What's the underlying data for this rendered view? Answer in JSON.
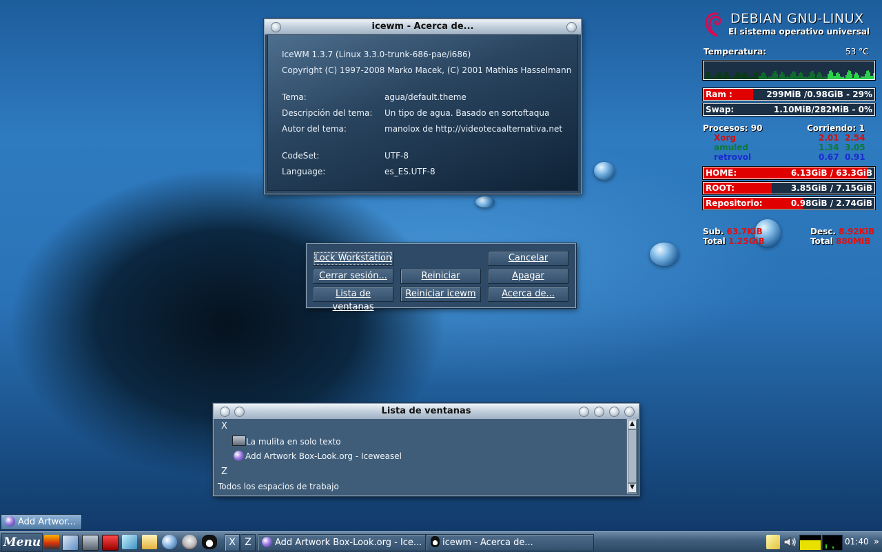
{
  "about": {
    "title": "icewm - Acerca de...",
    "version": "IceWM 1.3.7 (Linux 3.3.0-trunk-686-pae/i686)",
    "copyright": "Copyright (C) 1997-2008 Marko Macek, (C) 2001 Mathias Hasselmann",
    "theme_key": "Tema:",
    "theme_val": "agua/default.theme",
    "desc_key": "Descripción del tema:",
    "desc_val": "Un tipo de agua. Basado en sortoftaqua",
    "author_key": "Autor del tema:",
    "author_val": "manolox de http://videotecaalternativa.net",
    "codeset_key": "CodeSet:",
    "codeset_val": "UTF-8",
    "lang_key": "Language:",
    "lang_val": "es_ES.UTF-8"
  },
  "logout": {
    "lock": "Lock Workstation",
    "cancel": "Cancelar",
    "logout": "Cerrar sesión...",
    "reboot": "Reiniciar",
    "shutdown": "Apagar",
    "winlist": "Lista de ventanas",
    "restart_icewm": "Reiniciar icewm",
    "about": "Acerca de..."
  },
  "winlist": {
    "title": "Lista de ventanas",
    "ws_x": "X",
    "item1": "La mulita en solo texto",
    "item2": "Add  Artwork Box-Look.org - Iceweasel",
    "ws_z": "Z",
    "all": "Todos los espacios de trabajo"
  },
  "conky": {
    "logo_line1": "DEBIAN GNU-LINUX",
    "logo_line2": "El sistema operativo universal",
    "temp_label": "Temperatura:",
    "temp_value": "53 °C",
    "ram_label": "Ram :",
    "ram_value": "299MiB /0.98GiB - 29%",
    "ram_pct": 29,
    "swap_label": "Swap:",
    "swap_value": "1.10MiB/282MiB  - 0%",
    "swap_pct": 0,
    "procs_label": "Procesos: 90",
    "running_label": "Corriendo: 1",
    "procs": [
      {
        "name": "Xorg",
        "a": "2.01",
        "b": "2.54",
        "color": "#d01010"
      },
      {
        "name": "amuled",
        "a": "1.34",
        "b": "3.05",
        "color": "#0b7a3a"
      },
      {
        "name": "retrovol",
        "a": "0.67",
        "b": "0.91",
        "color": "#1a2ad0"
      }
    ],
    "home_label": "HOME:",
    "home_value": "6.13GiB / 63.3GiB",
    "home_pct": 96,
    "root_label": "ROOT:",
    "root_value": "3.85GiB / 7.15GiB",
    "root_pct": 40,
    "repo_label": "Repositorio:",
    "repo_value": "0.98GiB / 2.74GiB",
    "repo_pct": 58,
    "sub_label": "Sub.",
    "sub_value": "63.7KiB",
    "desc_label": "Desc.",
    "desc_value": "8.92KiB",
    "total_label": "Total",
    "total_up": "1.25GiB",
    "total_down": "880MiB"
  },
  "desktop": {
    "minimized_task": "Add  Artwor..."
  },
  "taskbar": {
    "menu": "Menu",
    "ws1": "X",
    "ws2": "Z",
    "task1": "Add  Artwork Box-Look.org - Ice...",
    "task2": "icewm - Acerca de...",
    "clock": "01:40"
  }
}
